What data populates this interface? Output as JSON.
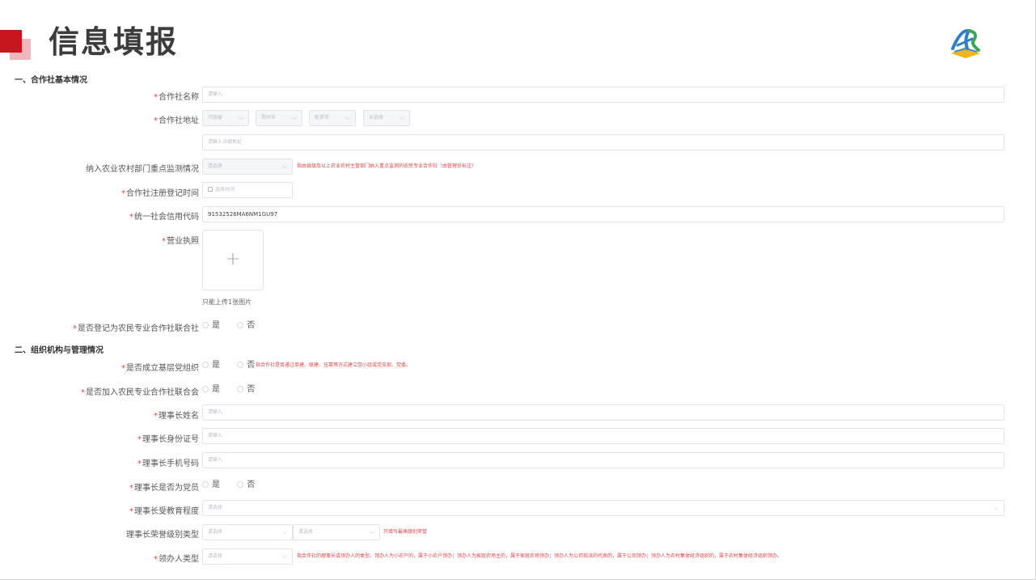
{
  "header": {
    "title": "信息填报",
    "accent_color": "#c8161e",
    "logo": "agri-logo-icon"
  },
  "section1": {
    "title": "一、合作社基本情况",
    "coop_name": {
      "label": "合作社名称",
      "placeholder": "请输入"
    },
    "coop_address": {
      "label": "合作社地址",
      "province": "河南省",
      "city": "郑州市",
      "county": "新郑市",
      "town": "未选择",
      "detail_placeholder": "请输入详细地址"
    },
    "monitoring": {
      "label": "纳入农业农村部门重点监测情况",
      "placeholder": "请选择",
      "hint": "指由县级及以上农业农村主管部门纳入重点监测的农民专业合作社（由管理员标注）"
    },
    "reg_time": {
      "label": "合作社注册登记时间",
      "placeholder": "选择时间"
    },
    "credit_code": {
      "label": "统一社会信用代码",
      "value": "91532526MA6NM1GU97"
    },
    "license": {
      "label": "营业执照",
      "upload_tip": "只能上传1张图片"
    },
    "is_union": {
      "label": "是否登记为农民专业合作社联合社",
      "yes": "是",
      "no": "否"
    }
  },
  "section2": {
    "title": "二、组织机构与管理情况",
    "party_org": {
      "label": "是否成立基层党组织",
      "yes": "是",
      "no": "否",
      "hint": "指合作社是否通过单建、联建、挂靠等方式建立党小组或党支部、党委。"
    },
    "join_union": {
      "label": "是否加入农民专业合作社联合会",
      "yes": "是",
      "no": "否"
    },
    "chair_name": {
      "label": "理事长姓名",
      "placeholder": "请输入"
    },
    "chair_id": {
      "label": "理事长身份证号",
      "placeholder": "请输入"
    },
    "chair_phone": {
      "label": "理事长手机号码",
      "placeholder": "请输入"
    },
    "chair_party": {
      "label": "理事长是否为党员",
      "yes": "是",
      "no": "否"
    },
    "chair_edu": {
      "label": "理事长受教育程度",
      "placeholder": "请选择"
    },
    "chair_honor": {
      "label": "理事长荣誉级别类型",
      "placeholder1": "请选择",
      "placeholder2": "请选择",
      "hint": "只填写最高级别荣誉"
    },
    "leader_type": {
      "label": "领办人类型",
      "placeholder": "请选择",
      "hint": "指合作社的理事长或领办人的类型。领办人为小农户的，属于小农户领办；领办人为家庭农场主的，属于家庭农场领办；领办人为公司指派的代表的，属于公司领办；领办人为农村集体经济组织的，属于农村集体经济组织领办。"
    }
  }
}
